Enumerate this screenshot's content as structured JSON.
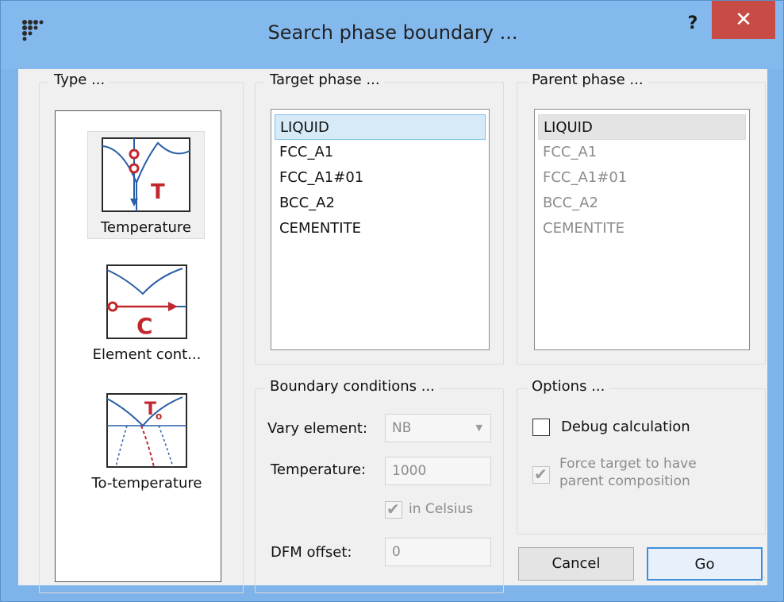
{
  "window": {
    "title": "Search  phase boundary ...",
    "help_label": "?",
    "close_label": "✕"
  },
  "type_group": {
    "title": "Type ...",
    "options": [
      {
        "label": "Temperature",
        "icon": "temperature-diagram-icon",
        "active": true,
        "glyph": "T"
      },
      {
        "label": "Element cont...",
        "icon": "element-content-diagram-icon",
        "active": false,
        "glyph": "C"
      },
      {
        "label": "To-temperature",
        "icon": "to-temperature-diagram-icon",
        "active": false,
        "glyph": "T₀"
      }
    ]
  },
  "target_phase": {
    "title": "Target phase ...",
    "items": [
      "LIQUID",
      "FCC_A1",
      "FCC_A1#01",
      "BCC_A2",
      "CEMENTITE"
    ],
    "selected_index": 0
  },
  "parent_phase": {
    "title": "Parent phase ...",
    "items": [
      "LIQUID",
      "FCC_A1",
      "FCC_A1#01",
      "BCC_A2",
      "CEMENTITE"
    ],
    "selected_index": 0
  },
  "boundary_conditions": {
    "title": "Boundary conditions ...",
    "vary_element_label": "Vary element:",
    "vary_element_value": "NB",
    "temperature_label": "Temperature:",
    "temperature_value": "1000",
    "in_celsius_label": "in Celsius",
    "in_celsius_checked": true,
    "dfm_offset_label": "DFM offset:",
    "dfm_offset_value": "0"
  },
  "options": {
    "title": "Options ...",
    "debug_label": "Debug calculation",
    "debug_checked": false,
    "force_label_line1": "Force target to have",
    "force_label_line2": "parent composition",
    "force_checked": true
  },
  "buttons": {
    "cancel": "Cancel",
    "go": "Go"
  },
  "colors": {
    "titlebar": "#84b9ee",
    "close": "#c84b45",
    "selection": "#d6eaf8",
    "diagram_red": "#c0282d",
    "diagram_blue": "#2a5ea8"
  }
}
